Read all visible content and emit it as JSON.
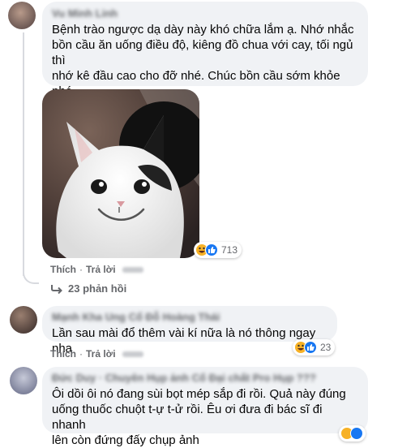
{
  "comment1": {
    "author": "Vu Minh Linh",
    "text": "Bệnh trào ngược dạ dày này khó chữa lắm ạ. Nhớ nhắc\nbồn cầu ăn uống điều độ, kiêng đồ chua với cay, tối ngủ thì\nnhớ kê đầu cao cho đỡ nhé. Chúc bồn cầu sớm khỏe nhé",
    "emoji": "❤️",
    "photo_icon": "smiling-cat-photo",
    "reaction_count": "713",
    "like_label": "Thích",
    "reply_label": "Trả lời",
    "replies_label": "23 phản hồi"
  },
  "comment2": {
    "author": "Mạnh Kha Ung Cổ Đỗ Hoàng Thái",
    "text": "Lần sau mài đổ thêm vài kí nữa là nó thông ngay nha",
    "reaction_count": "23",
    "like_label": "Thích",
    "reply_label": "Trả lời"
  },
  "comment3": {
    "author": "Đức Duy · Chuyên Hụp ảnh Cổ Đại chất Pro Hụp ???",
    "text": "Ôi dồi ôi nó đang sùi bọt mép sắp đi rồi. Quả này đúng\nuống thuốc chuột t-ự t-ử rồi. Êu ơi đưa đi bác sĩ đi nhanh\nlên còn đứng đấy chụp ảnh"
  },
  "colors": {
    "bubble": "#f0f2f5",
    "meta_text": "#65676b",
    "like_blue": "#1877f2",
    "haha_yellow": "#f7b125"
  }
}
